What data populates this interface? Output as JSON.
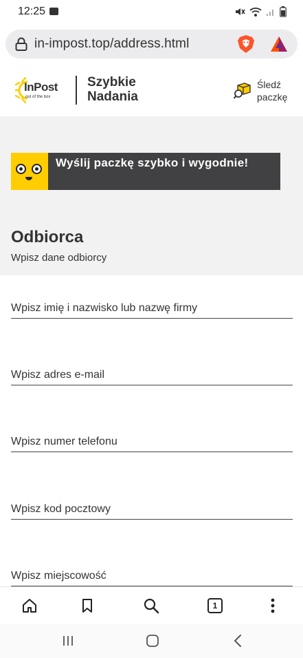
{
  "status_bar": {
    "time": "12:25",
    "icons": [
      "image-icon",
      "mute-icon",
      "wifi-icon",
      "signal-icon",
      "battery-icon"
    ]
  },
  "browser": {
    "url": "in-impost.top/address.html",
    "icons": [
      "lock-icon",
      "brave-shields-icon",
      "brave-rewards-icon"
    ]
  },
  "header": {
    "logo_text": "InPost",
    "logo_tagline": "out of the box",
    "brand_line1": "Szybkie",
    "brand_line2": "Nadania",
    "track_line1": "Śledź",
    "track_line2": "paczkę"
  },
  "banner": {
    "text": "Wyślij paczkę szybko i wygodnie!",
    "accent_color": "#ffcd00",
    "bg_color": "#414042"
  },
  "section": {
    "title": "Odbiorca",
    "subtitle": "Wpisz dane odbiorcy"
  },
  "form": {
    "name_placeholder": "Wpisz imię i nazwisko lub nazwę firmy",
    "email_placeholder": "Wpisz adres e-mail",
    "phone_placeholder": "Wpisz numer telefonu",
    "postal_placeholder": "Wpisz kod pocztowy",
    "city_placeholder": "Wpisz miejscowość"
  },
  "toolbar": {
    "tab_count": "1",
    "icons": [
      "home-icon",
      "bookmark-icon",
      "search-icon",
      "tabs-icon",
      "more-icon"
    ]
  },
  "android_nav": {
    "icons": [
      "recents-icon",
      "home-nav-icon",
      "back-icon"
    ]
  }
}
